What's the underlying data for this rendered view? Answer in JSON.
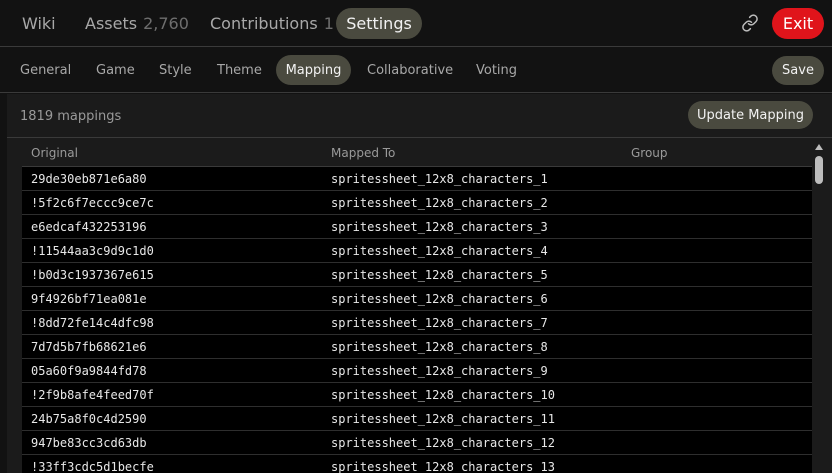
{
  "topnav": {
    "wiki": "Wiki",
    "assets": "Assets",
    "assets_count": "2,760",
    "contributions": "Contributions",
    "contributions_count": "1",
    "settings": "Settings",
    "exit": "Exit",
    "link_icon": "link-icon"
  },
  "subnav": {
    "tabs": [
      "General",
      "Game",
      "Style",
      "Theme",
      "Mapping",
      "Collaborative",
      "Voting"
    ],
    "active": "Mapping",
    "save": "Save"
  },
  "mapping": {
    "count_text": "1819 mappings",
    "update_button": "Update Mapping",
    "columns": [
      "Original",
      "Mapped To",
      "Group"
    ],
    "rows": [
      {
        "original": "29de30eb871e6a80",
        "mapped": "spritessheet_12x8_characters_1",
        "group": ""
      },
      {
        "original": "!5f2c6f7eccc9ce7c",
        "mapped": "spritessheet_12x8_characters_2",
        "group": ""
      },
      {
        "original": "e6edcaf432253196",
        "mapped": "spritessheet_12x8_characters_3",
        "group": ""
      },
      {
        "original": "!11544aa3c9d9c1d0",
        "mapped": "spritessheet_12x8_characters_4",
        "group": ""
      },
      {
        "original": "!b0d3c1937367e615",
        "mapped": "spritessheet_12x8_characters_5",
        "group": ""
      },
      {
        "original": "9f4926bf71ea081e",
        "mapped": "spritessheet_12x8_characters_6",
        "group": ""
      },
      {
        "original": "!8dd72fe14c4dfc98",
        "mapped": "spritessheet_12x8_characters_7",
        "group": ""
      },
      {
        "original": "7d7d5b7fb68621e6",
        "mapped": "spritessheet_12x8_characters_8",
        "group": ""
      },
      {
        "original": "05a60f9a9844fd78",
        "mapped": "spritessheet_12x8_characters_9",
        "group": ""
      },
      {
        "original": "!2f9b8afe4feed70f",
        "mapped": "spritessheet_12x8_characters_10",
        "group": ""
      },
      {
        "original": "24b75a8f0c4d2590",
        "mapped": "spritessheet_12x8_characters_11",
        "group": ""
      },
      {
        "original": "947be83cc3cd63db",
        "mapped": "spritessheet_12x8_characters_12",
        "group": ""
      },
      {
        "original": "!33ff3cdc5d1becfe",
        "mapped": "spritessheet_12x8_characters_13",
        "group": ""
      }
    ]
  },
  "colors": {
    "background": "#121212",
    "panel": "#1b1b1b",
    "pill": "#4a4a3f",
    "exit": "#e0141b"
  }
}
